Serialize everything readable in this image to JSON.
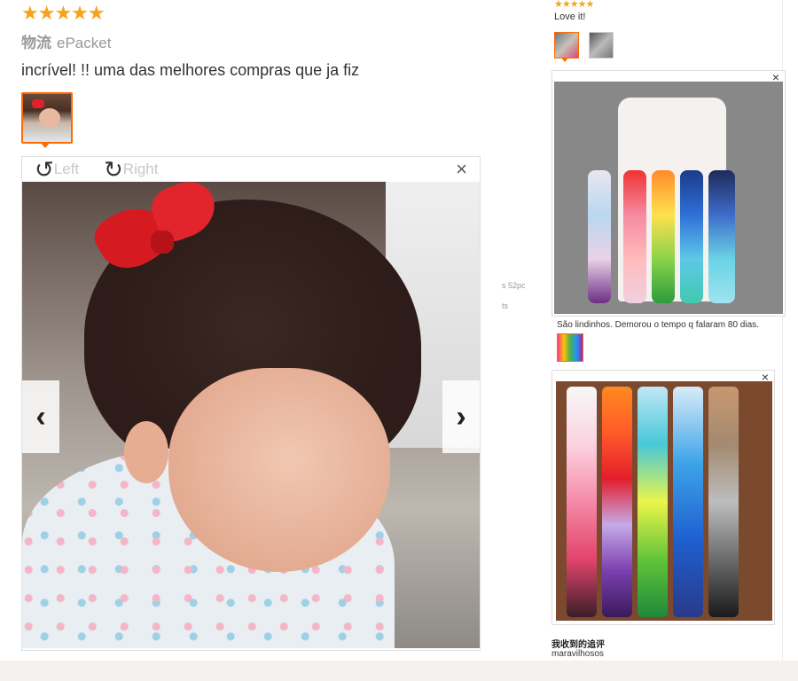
{
  "review_main": {
    "stars": "★★★★★",
    "shipping_label": "物流",
    "shipping_value": "ePacket",
    "text": "incrível! !! uma das melhores compras que ja fiz"
  },
  "viewer": {
    "rotate_left_label": "Left",
    "rotate_right_label": "Right",
    "close_glyph": "×",
    "prev_glyph": "‹",
    "next_glyph": "›"
  },
  "stray": {
    "line1": "s 52pc",
    "line2": "ts"
  },
  "review_right_1": {
    "stars": "★★★★★",
    "text": "Love it!",
    "caption": "São lindinhos. Demorou o tempo q falaram 80 dias.",
    "close_glyph": "×"
  },
  "review_right_2": {
    "close_glyph": "×",
    "label": "我收到的追评",
    "text": "maravilhosos"
  },
  "colors": {
    "accent": "#ff6a00",
    "star": "#f7a21b"
  }
}
